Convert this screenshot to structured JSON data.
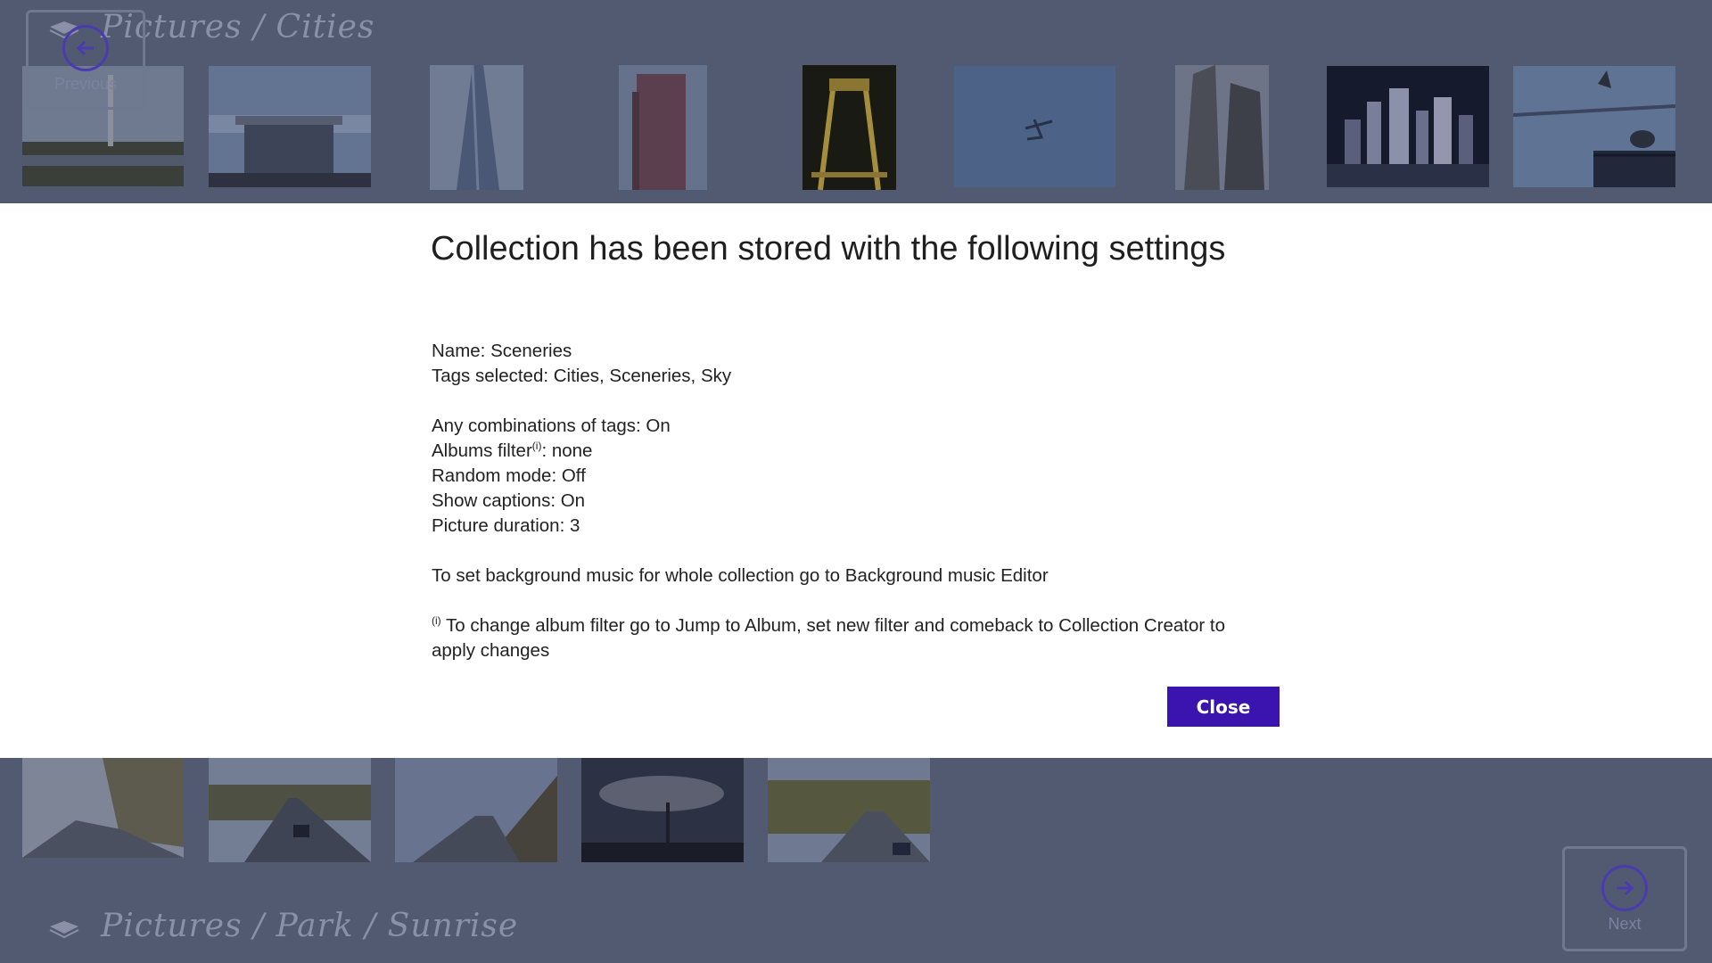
{
  "top_section": {
    "title": "Pictures / Cities"
  },
  "bottom_section": {
    "title": "Pictures / Park / Sunrise"
  },
  "nav": {
    "previous_label": "Previous",
    "next_label": "Next"
  },
  "dialog": {
    "title": "Collection has been stored with the following settings",
    "name_line": "Name: Sceneries",
    "tags_line": "Tags selected: Cities, Sceneries, Sky",
    "combinations_line": "Any combinations of tags: On",
    "albums_filter_label": "Albums filter",
    "albums_filter_marker": "(i)",
    "albums_filter_value": ": none",
    "random_mode_line": "Random mode: Off",
    "captions_line": "Show captions: On",
    "duration_line": "Picture duration: 3",
    "music_line": "To set background music for whole collection go to Background music Editor",
    "note_marker": "(i)",
    "note_text": " To change album filter go to Jump to Album, set new filter and comeback to Collection Creator to apply changes",
    "close_label": "Close"
  },
  "colors": {
    "accent": "#3b14b0",
    "overlay_bg": "#525a72",
    "dialog_bg": "#ffffff"
  }
}
